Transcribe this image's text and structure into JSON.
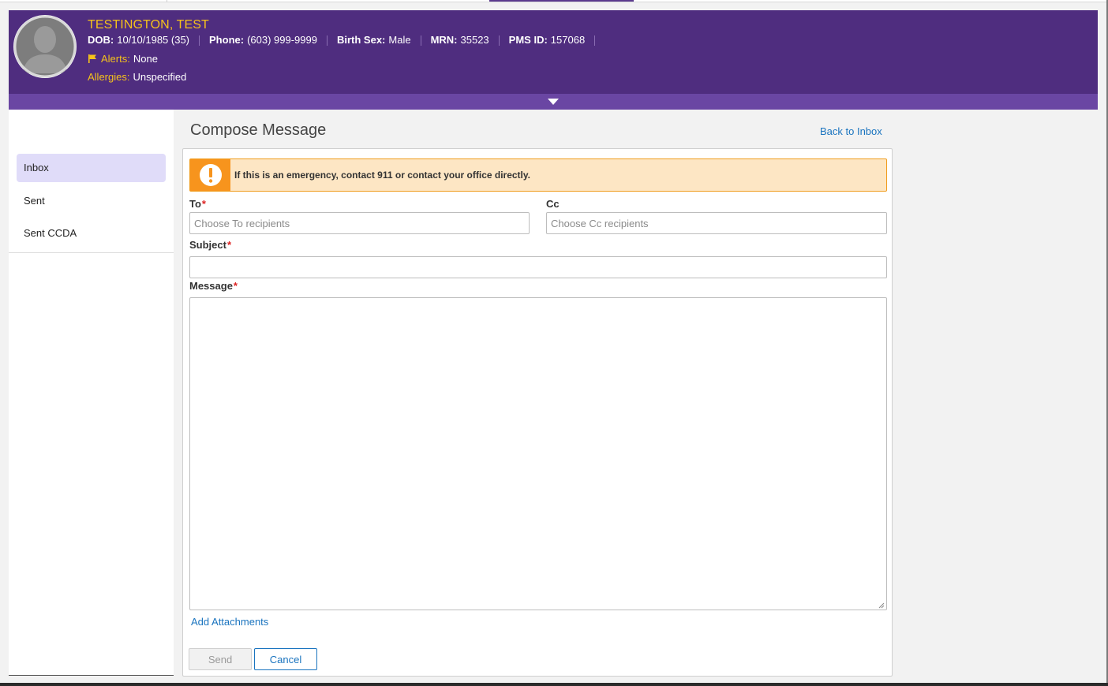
{
  "patient": {
    "name": "TESTINGTON, TEST",
    "dob_label": "DOB:",
    "dob_value": "10/10/1985 (35)",
    "phone_label": "Phone:",
    "phone_value": "(603) 999-9999",
    "birth_sex_label": "Birth Sex:",
    "birth_sex_value": "Male",
    "mrn_label": "MRN:",
    "mrn_value": "35523",
    "pms_label": "PMS ID:",
    "pms_value": "157068",
    "alerts_label": "Alerts:",
    "alerts_value": "None",
    "allergies_label": "Allergies:",
    "allergies_value": "Unspecified"
  },
  "sidebar": {
    "items": [
      {
        "label": "Inbox",
        "active": true
      },
      {
        "label": "Sent",
        "active": false
      },
      {
        "label": "Sent CCDA",
        "active": false
      }
    ]
  },
  "compose": {
    "title": "Compose Message",
    "back_link": "Back to Inbox",
    "alert_text": "If this is an emergency, contact 911 or contact your office directly.",
    "to_label": "To",
    "to_placeholder": "Choose To recipients",
    "cc_label": "Cc",
    "cc_placeholder": "Choose Cc recipients",
    "subject_label": "Subject",
    "message_label": "Message",
    "required_mark": "*",
    "attach_link": "Add Attachments",
    "send_label": "Send",
    "cancel_label": "Cancel"
  },
  "colors": {
    "banner": "#4f2d7f",
    "accent_yellow": "#f5c21b",
    "link_blue": "#1a74bf",
    "alert_orange": "#f7941d",
    "active_nav": "#e0dcf9"
  }
}
